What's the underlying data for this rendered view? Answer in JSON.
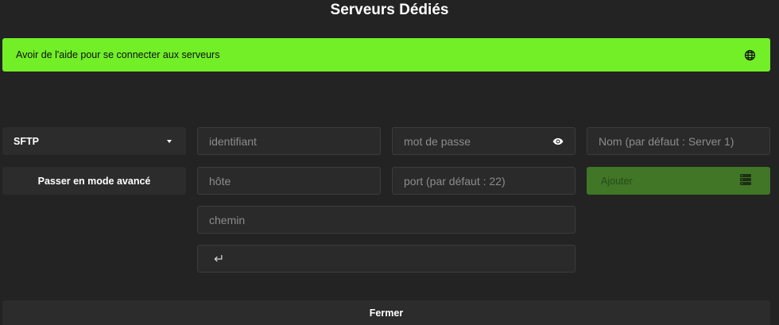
{
  "page": {
    "title": "Serveurs Dédiés"
  },
  "help": {
    "label": "Avoir de l'aide pour se connecter aux serveurs",
    "icon": "globe-icon"
  },
  "protocol": {
    "selected": "SFTP",
    "icon": "caret-down-icon"
  },
  "mode_button": {
    "label": "Passer en mode avancé"
  },
  "fields": {
    "username": {
      "placeholder": "identifiant",
      "value": ""
    },
    "password": {
      "placeholder": "mot de passe",
      "value": "",
      "icon": "eye-icon"
    },
    "name": {
      "placeholder": "Nom (par défaut : Server 1)",
      "value": ""
    },
    "host": {
      "placeholder": "hôte",
      "value": ""
    },
    "port": {
      "placeholder": "port (par défaut : 22)",
      "value": ""
    },
    "path": {
      "placeholder": "chemin",
      "value": ""
    }
  },
  "add_button": {
    "label": "Ajouter",
    "icon": "server-icon"
  },
  "enter": {
    "glyph": "↵"
  },
  "close_button": {
    "label": "Fermer"
  },
  "colors": {
    "background": "#232323",
    "help_bar": "#72ef27",
    "add_button": "#407626",
    "field": "#2a2a2a",
    "button": "#2c2c2c"
  }
}
